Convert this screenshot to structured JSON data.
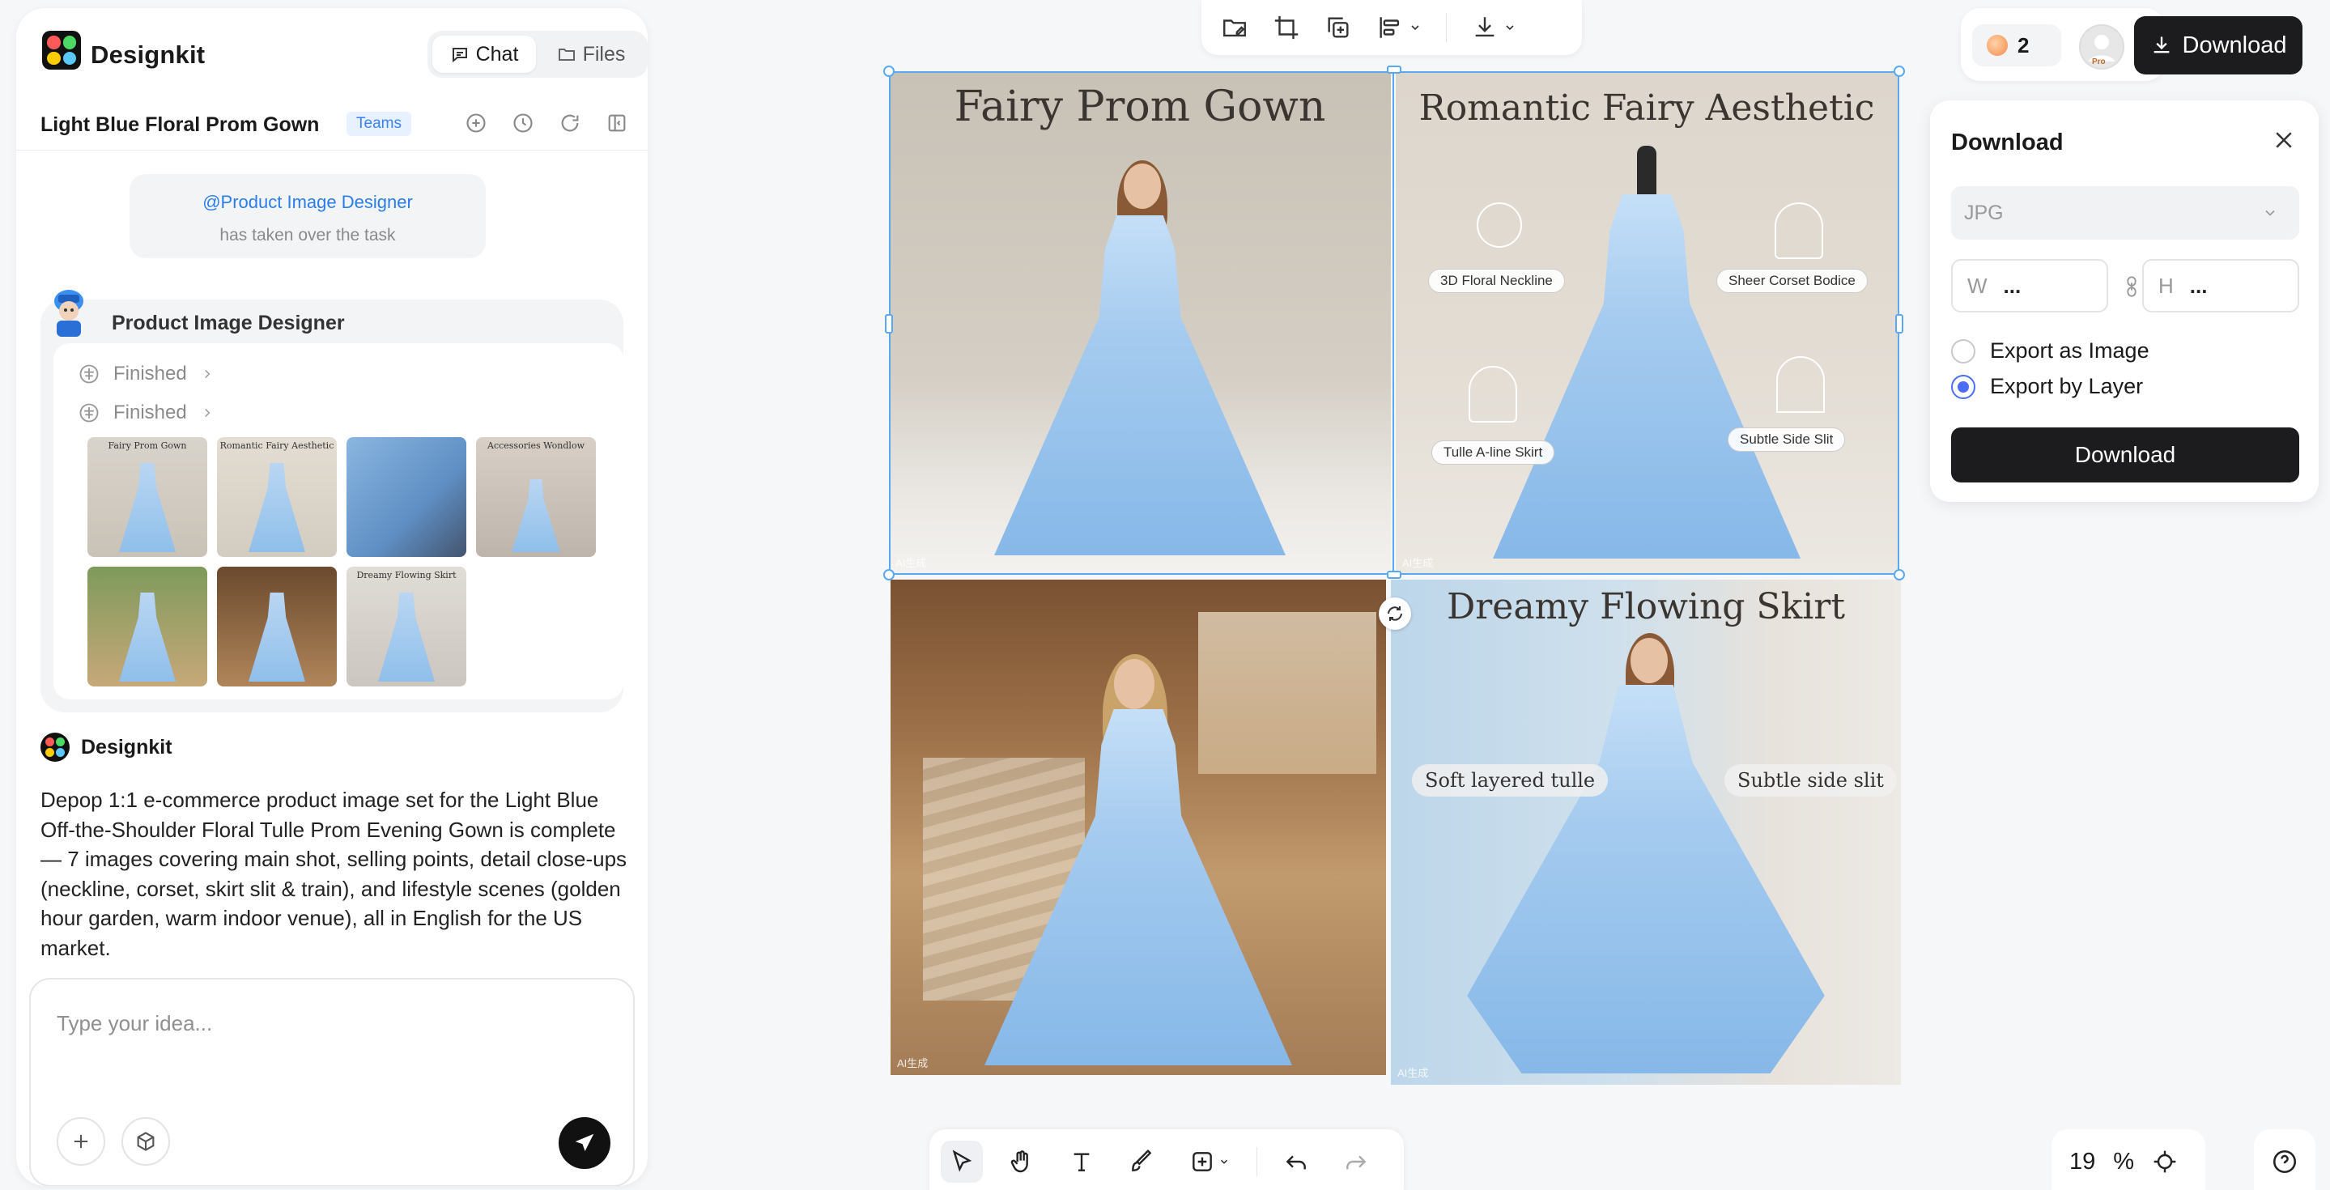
{
  "app": {
    "name": "Designkit"
  },
  "header": {
    "tabs": [
      {
        "label": "Chat",
        "active": true
      },
      {
        "label": "Files",
        "active": false
      }
    ]
  },
  "project": {
    "title": "Light Blue Floral Prom Gown",
    "badge": "Teams"
  },
  "takeover": {
    "mention": "@Product Image Designer",
    "text": "has taken over the task"
  },
  "agent": {
    "name": "Product Image Designer",
    "steps": [
      {
        "label": "Finished"
      },
      {
        "label": "Finished"
      }
    ],
    "thumbnails": [
      {
        "title": "Fairy Prom Gown"
      },
      {
        "title": "Romantic Fairy Aesthetic"
      },
      {
        "title": ""
      },
      {
        "title": "Accessories Wondlow"
      },
      {
        "title": ""
      },
      {
        "title": ""
      },
      {
        "title": "Dreamy Flowing Skirt"
      }
    ]
  },
  "assistant": {
    "name": "Designkit",
    "message": "Depop 1:1 e-commerce product image set for the Light Blue Off-the-Shoulder Floral Tulle Prom Evening Gown is complete — 7 images covering main shot, selling points, detail close-ups (neckline, corset, skirt slit & train), and lifestyle scenes (golden hour garden, warm indoor venue), all in English for the US market."
  },
  "composer": {
    "placeholder": "Type your idea..."
  },
  "topbar": {
    "credits": "2",
    "pro": "Pro",
    "download_label": "Download"
  },
  "download_panel": {
    "title": "Download",
    "format": "JPG",
    "width_label": "W",
    "width_value": "...",
    "height_label": "H",
    "height_value": "...",
    "options": [
      {
        "label": "Export as Image",
        "selected": false
      },
      {
        "label": "Export by Layer",
        "selected": true
      }
    ],
    "button_label": "Download"
  },
  "canvas": {
    "images": [
      {
        "title": "Fairy Prom Gown",
        "ai_tag": "AI生成"
      },
      {
        "title": "Romantic Fairy Aesthetic",
        "ai_tag": "AI生成",
        "features": [
          "3D Floral Neckline",
          "Sheer Corset Bodice",
          "Tulle A-line Skirt",
          "Subtle Side Slit"
        ]
      },
      {
        "title": "",
        "ai_tag": "AI生成"
      },
      {
        "title": "Dreamy Flowing Skirt",
        "ai_tag": "AI生成",
        "labels": [
          "Soft layered tulle",
          "Subtle side slit"
        ]
      }
    ]
  },
  "zoom": {
    "value": "19",
    "unit": "%"
  }
}
